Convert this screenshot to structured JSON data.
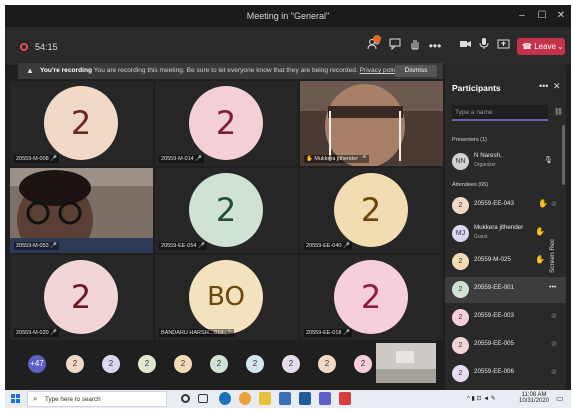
{
  "window": {
    "title": "Meeting in \"General\"",
    "controls": [
      "–",
      "☐",
      "✕"
    ]
  },
  "toolbar": {
    "recording_time": "54:15",
    "leave_label": "Leave",
    "icons": [
      "participants-icon",
      "chat-icon",
      "raise-hand-icon",
      "more-icon",
      "camera-icon",
      "mic-icon",
      "share-icon"
    ]
  },
  "banner": {
    "bold": "You're recording",
    "text": "You are recording this meeting. Be sure to let everyone know that they are being recorded.",
    "link": "Privacy policy",
    "dismiss": "Dismiss"
  },
  "tiles": [
    {
      "name": "20559-M-008",
      "avatar": "2",
      "bg": "#f1d9c7",
      "fg": "#6b2626"
    },
    {
      "name": "20559-M-014",
      "avatar": "2",
      "bg": "#f3d0d6",
      "fg": "#7a1c3a"
    },
    {
      "name": "Mukkera jithender",
      "avatar": "",
      "video": true
    },
    {
      "name": "20559-M-053",
      "avatar": "",
      "video": true
    },
    {
      "name": "20559-EE-054",
      "avatar": "2",
      "bg": "#cfe2d4",
      "fg": "#1e5034"
    },
    {
      "name": "20559-EE-040",
      "avatar": "2",
      "bg": "#f2dcb2",
      "fg": "#6b4608"
    },
    {
      "name": "20559-M-020",
      "avatar": "2",
      "bg": "#f2d5d6",
      "fg": "#6b1b1f"
    },
    {
      "name": "BANDARU HARSH…019",
      "avatar": "BO",
      "bg": "#f3e2bd",
      "fg": "#6b4608"
    },
    {
      "name": "20559-EE-018",
      "avatar": "2",
      "bg": "#f6cfdb",
      "fg": "#8a1c45"
    }
  ],
  "strip": {
    "overflow": "+47",
    "avatars": [
      {
        "label": "2",
        "bg": "#f0d9c6"
      },
      {
        "label": "2",
        "bg": "#d9d8f0"
      },
      {
        "label": "2",
        "bg": "#dfe8cf"
      },
      {
        "label": "2",
        "bg": "#f1dcb6"
      },
      {
        "label": "2",
        "bg": "#cfe2d4"
      },
      {
        "label": "2",
        "bg": "#d6e6ef"
      },
      {
        "label": "2",
        "bg": "#e7dcef"
      },
      {
        "label": "2",
        "bg": "#f0d9c6"
      },
      {
        "label": "2",
        "bg": "#f6cfdb"
      }
    ]
  },
  "panel": {
    "title": "Participants",
    "search_placeholder": "Type a name",
    "presenters_label": "Presenters (1)",
    "attendees_label": "Attendees (65)",
    "presenter": {
      "name": "N Naresh,",
      "role": "Organizer",
      "initials": "NN"
    },
    "attendees": [
      {
        "name": "20559-EE-043",
        "initials": "2",
        "bg": "#f0d9c6",
        "hand": true
      },
      {
        "name": "Mukkera jithender",
        "sub": "Guest",
        "initials": "MJ",
        "bg": "#d9d8f0",
        "hand": true
      },
      {
        "name": "20559-M-025",
        "initials": "2",
        "bg": "#f1dcb6",
        "hand": true
      },
      {
        "name": "20559-EE-001",
        "initials": "2",
        "bg": "#cfe2d4",
        "active": true
      },
      {
        "name": "20559-EE-003",
        "initials": "2",
        "bg": "#f6cfdb"
      },
      {
        "name": "20559-EE-005",
        "initials": "2",
        "bg": "#f2d5d6"
      },
      {
        "name": "20559-EE-006",
        "initials": "2",
        "bg": "#e7dcef"
      }
    ],
    "recording_vertical": "Screen Rec"
  },
  "taskbar": {
    "search_placeholder": "Type here to search",
    "time": "11:08 AM",
    "date": "10/31/2020"
  }
}
